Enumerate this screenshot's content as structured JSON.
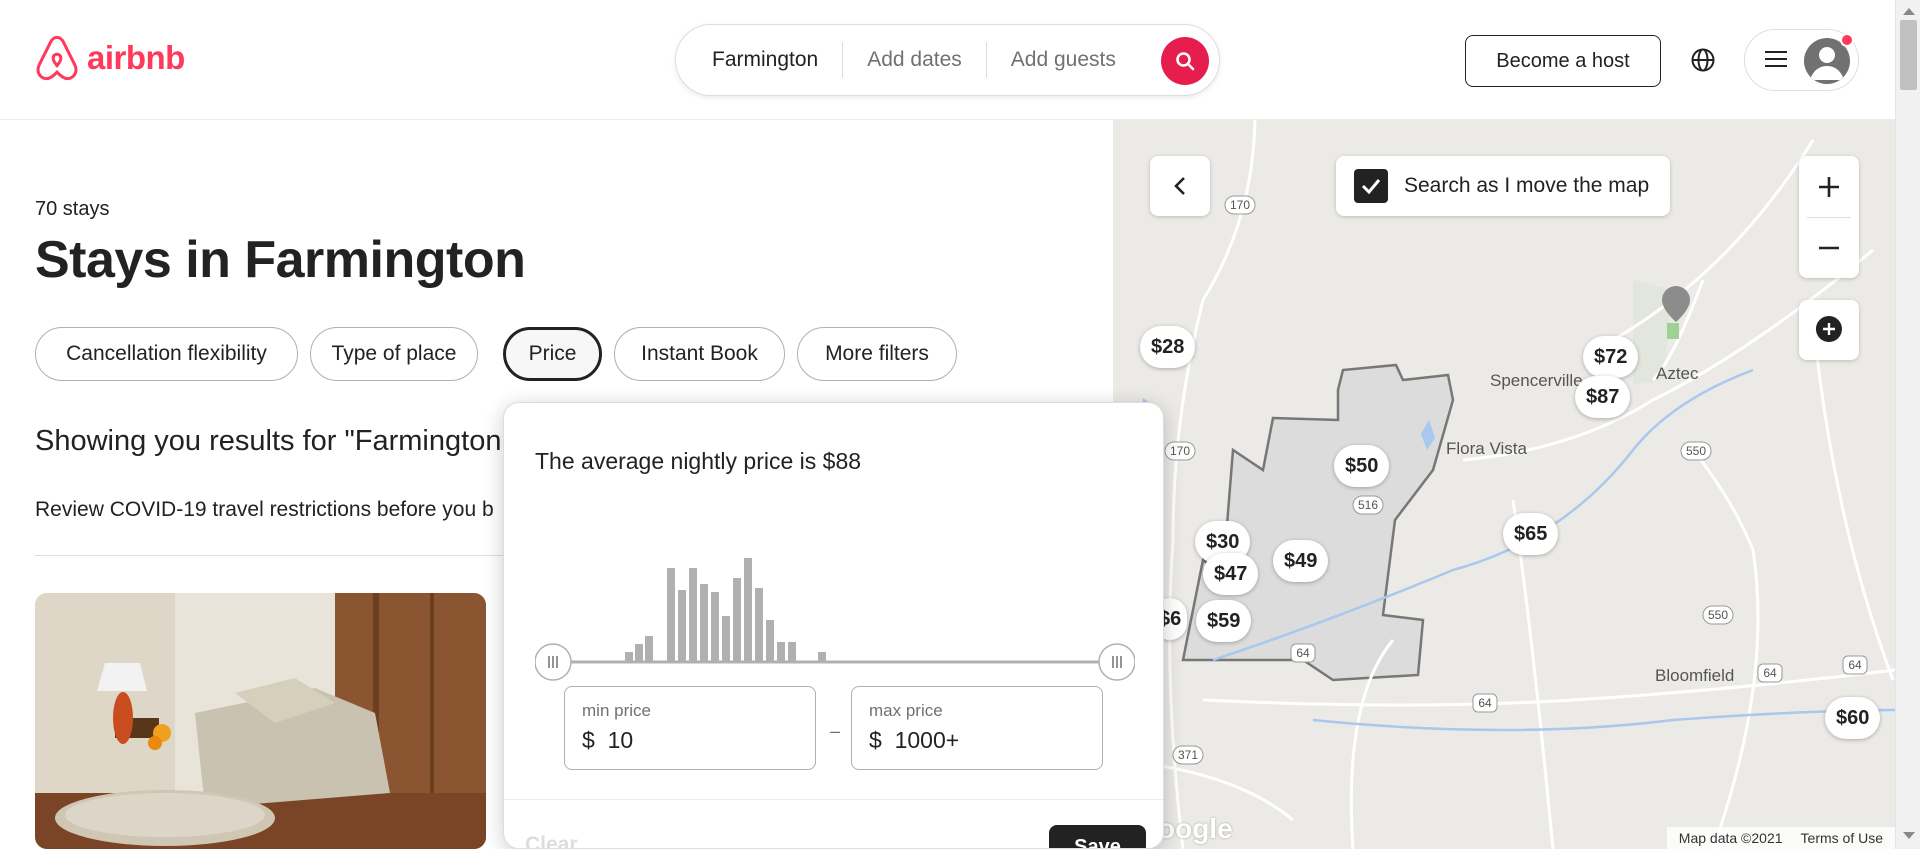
{
  "header": {
    "logo_text": "airbnb",
    "search": {
      "location": "Farmington",
      "dates": "Add dates",
      "guests": "Add guests"
    },
    "become_host": "Become a host"
  },
  "main": {
    "stays_count": "70 stays",
    "title": "Stays in Farmington",
    "filters": [
      "Cancellation flexibility",
      "Type of place",
      "Price",
      "Instant Book",
      "More filters"
    ],
    "results_text": "Showing you results for \"Farmington",
    "covid_text": "Review COVID-19 travel restrictions before you b"
  },
  "price_popover": {
    "avg_text": "The average nightly price is $88",
    "min_label": "min price",
    "min_currency": "$",
    "min_value": "10",
    "max_label": "max price",
    "max_currency": "$",
    "max_value": "1000+",
    "dash": "–",
    "clear": "Clear",
    "save": "Save"
  },
  "map": {
    "search_toggle": "Search as I move the map",
    "search_toggle_checked": true,
    "pins": [
      "$28",
      "$72",
      "$87",
      "$50",
      "$65",
      "$30",
      "$47",
      "$49",
      "$59",
      "$6",
      "$60"
    ],
    "places": [
      "Spencerville",
      "Aztec",
      "Flora Vista",
      "Bloomfield"
    ],
    "route_labels": [
      "170",
      "170",
      "516",
      "550",
      "550",
      "64",
      "64",
      "64",
      "64",
      "371"
    ],
    "footer": [
      "Map data ©2021",
      "Terms of Use"
    ],
    "google": "oogle"
  },
  "colors": {
    "brand": "#FF385C",
    "search_button": "#E61E4D",
    "histogram_bar": "#b0b0b0"
  }
}
